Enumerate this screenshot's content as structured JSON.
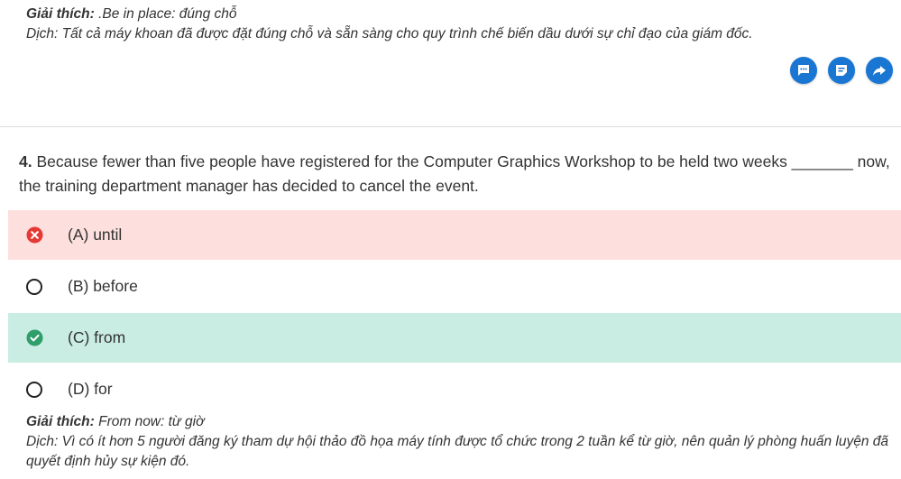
{
  "previous_explanation": {
    "label": "Giải thích:",
    "text": " .Be in place: đúng chỗ",
    "translation": "Dịch: Tất cả máy khoan đã được đặt đúng chỗ và sẵn sàng cho quy trình chế biến dầu dưới sự chỉ đạo của giám đốc."
  },
  "actions": {
    "icons": [
      "comment-icon",
      "note-icon",
      "share-icon"
    ],
    "color": "#1976d2"
  },
  "question": {
    "number": "4.",
    "text": " Because fewer than five people have registered for the Computer Graphics Workshop to be held two weeks _______ now, the training department manager has decided to cancel the event."
  },
  "options": [
    {
      "label": "(A) until",
      "state": "wrong"
    },
    {
      "label": "(B) before",
      "state": "unselected"
    },
    {
      "label": "(C) from",
      "state": "correct"
    },
    {
      "label": "(D) for",
      "state": "unselected"
    }
  ],
  "explanation": {
    "label": "Giải thích:",
    "text": " From now: từ giờ",
    "translation": "Dịch: Vì có ít hơn 5 người đăng ký tham dự hội thảo đồ họa máy tính được tổ chức trong 2 tuần kể từ giờ, nên quản lý phòng huấn luyện đã quyết định hủy sự kiện đó."
  },
  "colors": {
    "wrong_bg": "#fde0dd",
    "correct_bg": "#c9ede2",
    "wrong_icon": "#e53935",
    "correct_icon": "#2e9e6a"
  }
}
